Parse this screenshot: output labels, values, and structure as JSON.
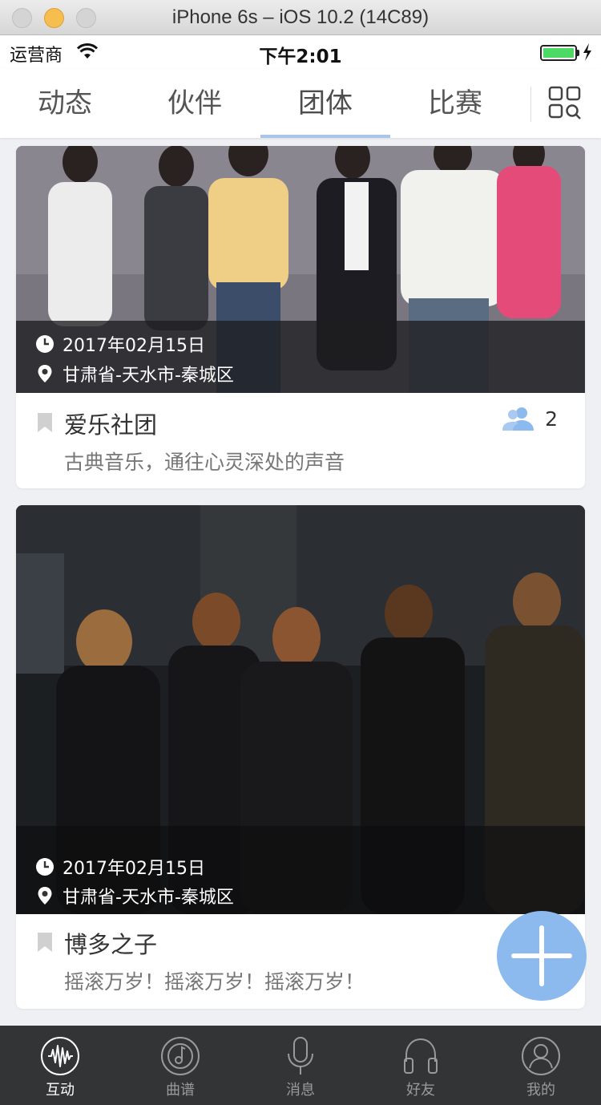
{
  "simulator": {
    "title": "iPhone 6s – iOS 10.2 (14C89)"
  },
  "status_bar": {
    "carrier": "运营商",
    "time": "下午2:01",
    "battery_level": 1.0,
    "battery_color": "#4cd964"
  },
  "top_tabs": {
    "items": [
      {
        "label": "动态"
      },
      {
        "label": "伙伴"
      },
      {
        "label": "团体"
      },
      {
        "label": "比赛"
      }
    ],
    "active_index": 2,
    "accent": "#a9c5e8",
    "menu_icon": "grid-search-icon"
  },
  "groups": [
    {
      "date": "2017年02月15日",
      "location": "甘肃省-天水市-秦城区",
      "name": "爱乐社团",
      "description": "古典音乐，通往心灵深处的声音",
      "member_count": "2"
    },
    {
      "date": "2017年02月15日",
      "location": "甘肃省-天水市-秦城区",
      "name": "博多之子",
      "description": "摇滚万岁！摇滚万岁！摇滚万岁！"
    }
  ],
  "fab": {
    "icon": "plus-icon",
    "color": "#8cb9ee"
  },
  "bottom_tabs": {
    "items": [
      {
        "label": "互动",
        "icon": "waveform-icon"
      },
      {
        "label": "曲谱",
        "icon": "disc-icon"
      },
      {
        "label": "消息",
        "icon": "microphone-icon"
      },
      {
        "label": "好友",
        "icon": "headphones-icon"
      },
      {
        "label": "我的",
        "icon": "user-icon"
      }
    ],
    "active_index": 0
  }
}
